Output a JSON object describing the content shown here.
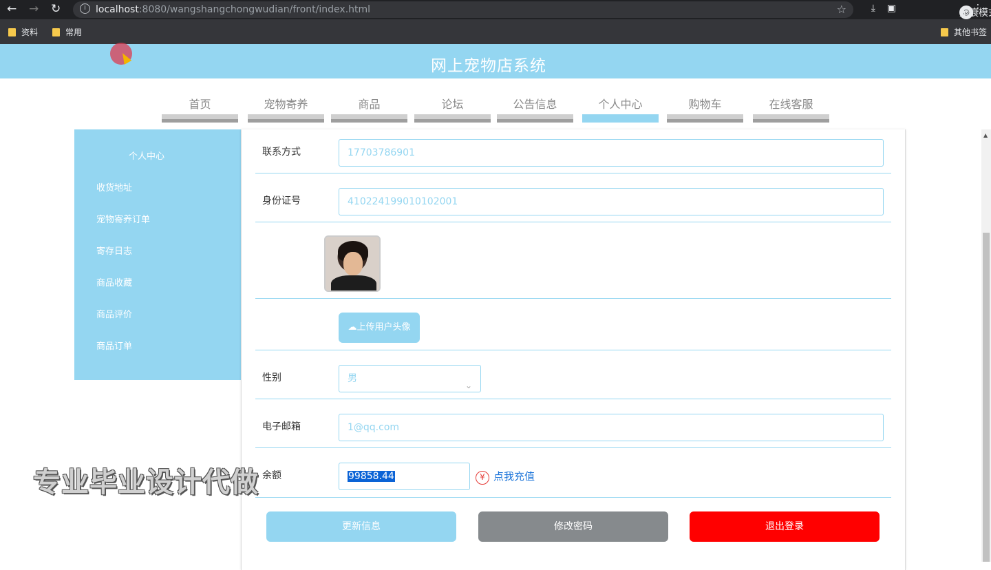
{
  "browser": {
    "url_host": "localhost",
    "url_rest": ":8080/wangshangchongwudian/front/index.html",
    "incognito_label": "无痕模式",
    "bookmarks": [
      "资料",
      "常用"
    ],
    "other_bookmarks": "其他书签"
  },
  "site": {
    "title": "网上宠物店系统"
  },
  "nav": {
    "items": [
      "首页",
      "宠物寄养",
      "商品",
      "论坛",
      "公告信息",
      "个人中心",
      "购物车",
      "在线客服"
    ],
    "active": "个人中心"
  },
  "sidebar": {
    "title": "个人中心",
    "items": [
      "收货地址",
      "宠物寄养订单",
      "寄存日志",
      "商品收藏",
      "商品评价",
      "商品订单"
    ]
  },
  "form": {
    "contact_label": "联系方式",
    "contact_value": "17703786901",
    "id_label": "身份证号",
    "id_value": "410224199010102001",
    "upload_label": "上传用户头像",
    "gender_label": "性别",
    "gender_value": "男",
    "email_label": "电子邮箱",
    "email_value": "1@qq.com",
    "balance_label": "余额",
    "balance_value": "99858.44",
    "recharge_label": "点我充值"
  },
  "buttons": {
    "update": "更新信息",
    "change_password": "修改密码",
    "logout": "退出登录"
  },
  "watermark": "专业毕业设计代做"
}
